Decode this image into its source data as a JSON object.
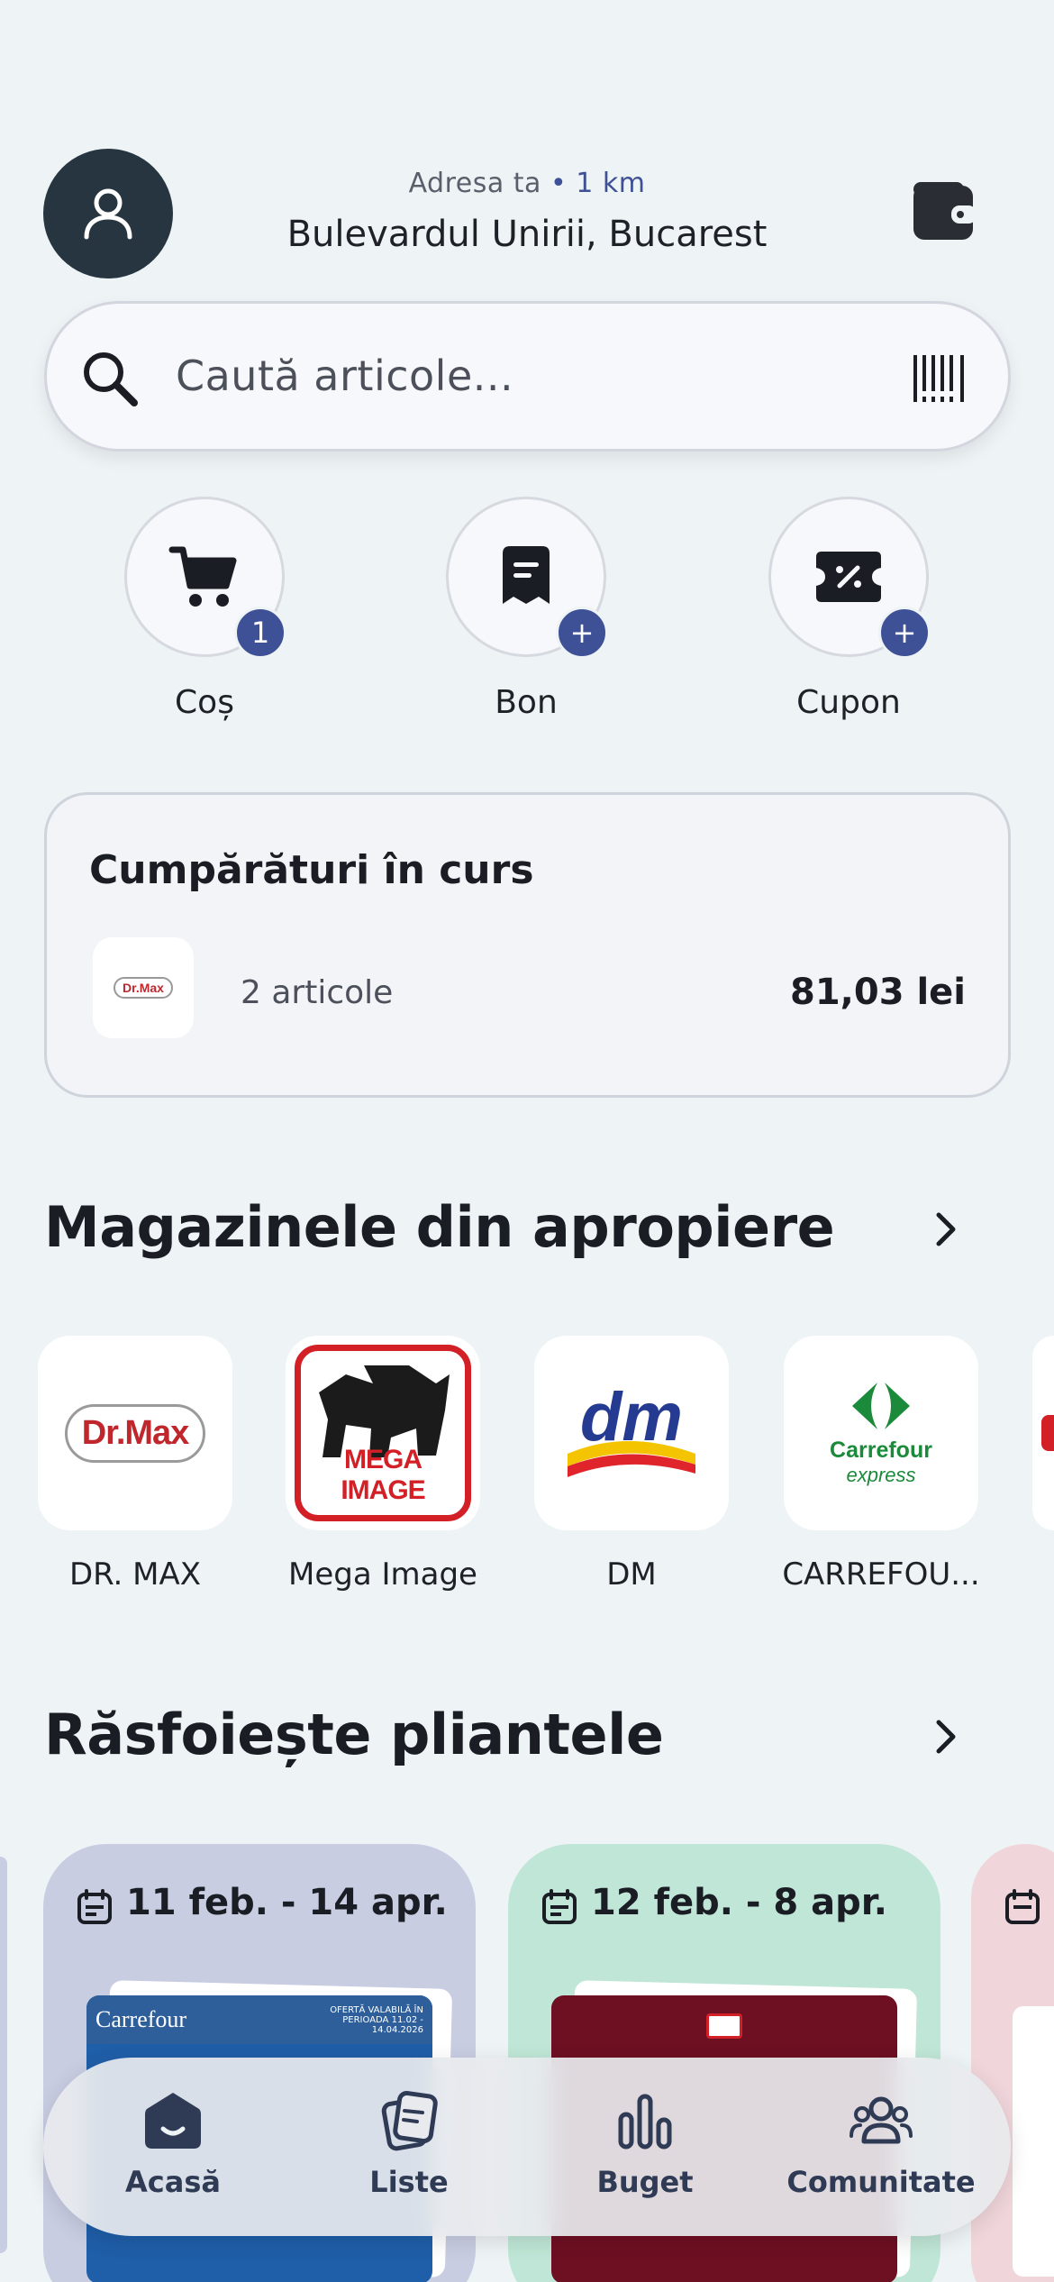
{
  "header": {
    "address_label": "Adresa ta",
    "distance": "• 1 km",
    "street": "Bulevardul Unirii, Bucarest",
    "avatar_icon": "user-icon",
    "wallet_icon": "wallet-icon"
  },
  "search": {
    "placeholder": "Caută articole...",
    "icon": "search-icon",
    "scan_icon": "barcode-icon"
  },
  "quick_actions": [
    {
      "label": "Coș",
      "badge": "1",
      "icon": "cart-icon"
    },
    {
      "label": "Bon",
      "badge": "+",
      "icon": "receipt-icon"
    },
    {
      "label": "Cupon",
      "badge": "+",
      "icon": "coupon-icon"
    }
  ],
  "ongoing": {
    "title": "Cumpărături în curs",
    "store_logo": "Dr.Max",
    "count": "2 articole",
    "price": "81,03 lei"
  },
  "nearby": {
    "title": "Magazinele din apropiere",
    "stores": [
      {
        "name": "DR. MAX",
        "logo": "Dr.Max"
      },
      {
        "name": "Mega Image",
        "logo": "MEGA IMAGE"
      },
      {
        "name": "DM",
        "logo": "dm"
      },
      {
        "name": "CARREFOU...",
        "logo_line1": "Carrefour",
        "logo_line2": "express"
      }
    ]
  },
  "flyers": {
    "title": "Răsfoiește pliantele",
    "items": [
      {
        "date": "11 feb. - 14 apr.",
        "color": "#c9cde2",
        "brand": "Carrefour",
        "note": "OFERTĂ VALABILĂ ÎN PERIOADA 11.02 - 14.04.2026"
      },
      {
        "date": "12 feb. - 8 apr.",
        "color": "#bfe6d6"
      },
      {
        "date": "",
        "color": "#f0d6db"
      }
    ]
  },
  "nav": [
    {
      "label": "Acasă",
      "icon": "home-icon",
      "active": true
    },
    {
      "label": "Liste",
      "icon": "list-icon"
    },
    {
      "label": "Buget",
      "icon": "chart-icon"
    },
    {
      "label": "Comunitate",
      "icon": "community-icon"
    }
  ],
  "colors": {
    "accent": "#3f5196",
    "dark": "#26353f",
    "background": "#eef3f6"
  }
}
